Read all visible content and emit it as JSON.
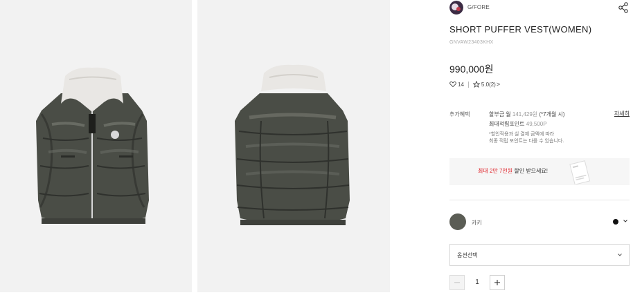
{
  "gallery": {
    "images": [
      {
        "name": "vest-front-view",
        "alt": ""
      },
      {
        "name": "vest-back-view",
        "alt": ""
      }
    ]
  },
  "product": {
    "brand": "G/FORE",
    "title": "SHORT PUFFER VEST(WOMEN)",
    "code": "GNVAW23403KHX",
    "price": "990,000원",
    "likes": "14",
    "rating": "5.0",
    "review_count": "(2)"
  },
  "benefits": {
    "label": "추가혜택",
    "installment": {
      "prefix": "할부금 월 ",
      "amount": "141,429원",
      "suffix": " (*7개월 시)"
    },
    "points": {
      "prefix": "최대적립포인트 ",
      "amount": "49,500P"
    },
    "note_line1": "*할인적용과 실 결제 금액에 따라",
    "note_line2": "최종 적립 포인트는 다를 수 있습니다.",
    "detail_link": "자세히"
  },
  "promo": {
    "highlight": "최대 2만 7천원",
    "text": " 할인 받으세요!"
  },
  "color": {
    "label": "카키",
    "swatch": "#5b5d55",
    "selected_dot": "#111111"
  },
  "option": {
    "placeholder": "옵션선택"
  },
  "quantity": {
    "value": "1"
  },
  "icons": {
    "share": "share-icon",
    "heart": "heart-icon",
    "star": "star-icon",
    "chevron": "chevron-down-icon",
    "minus": "minus-icon",
    "plus": "plus-icon"
  },
  "colors": {
    "accent_red": "#e0242b",
    "panel_bg": "#f2f2f2",
    "vest_khaki": "#4a4d46",
    "collar_fleece": "#e9e7e4"
  }
}
